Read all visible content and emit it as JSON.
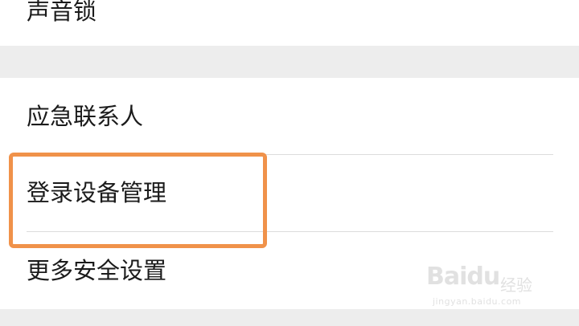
{
  "settings": {
    "top_item_label": "声音锁",
    "items": [
      {
        "label": "应急联系人"
      },
      {
        "label": "登录设备管理"
      },
      {
        "label": "更多安全设置"
      }
    ]
  },
  "highlight": {
    "color": "#f0924a"
  },
  "watermark": {
    "logo": "Bai",
    "logo_suffix": "du",
    "cn": "经验",
    "url": "jingyan.baidu.com"
  }
}
